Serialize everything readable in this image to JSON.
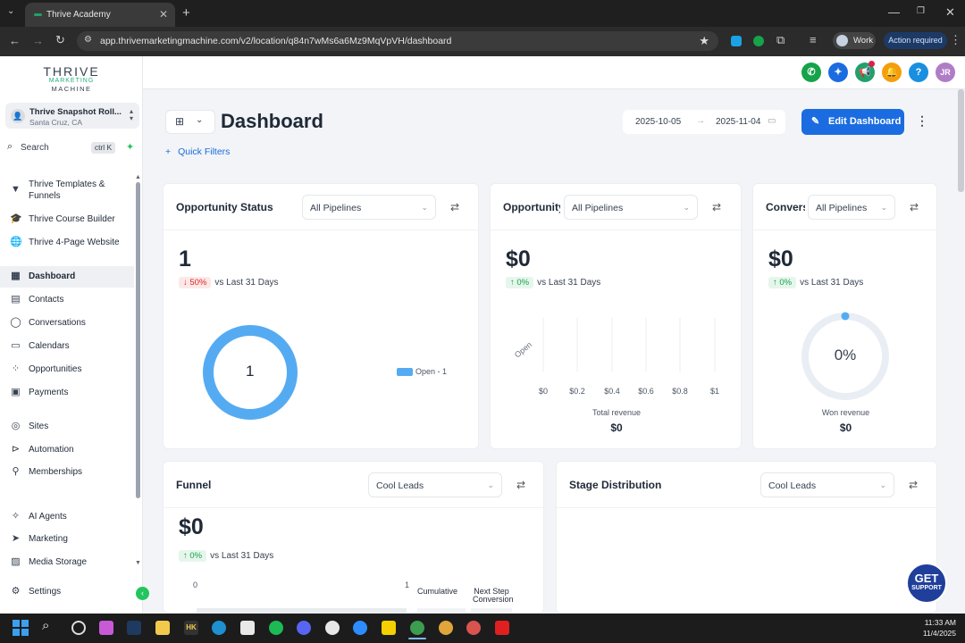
{
  "browser": {
    "tab_title": "Thrive Academy",
    "url": "app.thrivemarketingmachine.com/v2/location/q84n7wMs6a6Mz9MqVpVH/dashboard",
    "profile_label": "Work",
    "action_required": "Action required"
  },
  "sidebar": {
    "logo_line1": "THRIVE",
    "logo_line2": "MARKETING",
    "logo_line3": "MACHINE",
    "location_name": "Thrive Snapshot Roll...",
    "location_sub": "Santa Cruz, CA",
    "search_label": "Search",
    "search_shortcut": "ctrl K",
    "pinned": [
      {
        "label": "Thrive Templates &",
        "label2": "Funnels",
        "icon": "filter-icon"
      },
      {
        "label": "Thrive Course Builder",
        "icon": "graduation-cap-icon"
      },
      {
        "label": "Thrive 4-Page Website",
        "icon": "globe-icon"
      }
    ],
    "nav": [
      {
        "label": "Dashboard",
        "icon": "dashboard-icon",
        "active": true
      },
      {
        "label": "Contacts",
        "icon": "contacts-icon"
      },
      {
        "label": "Conversations",
        "icon": "chat-icon"
      },
      {
        "label": "Calendars",
        "icon": "calendar-icon"
      },
      {
        "label": "Opportunities",
        "icon": "opportunities-icon"
      },
      {
        "label": "Payments",
        "icon": "payments-icon"
      },
      {
        "label": "Sites",
        "icon": "sites-icon"
      },
      {
        "label": "Automation",
        "icon": "automation-icon"
      },
      {
        "label": "Memberships",
        "icon": "memberships-icon"
      },
      {
        "label": "AI Agents",
        "icon": "ai-agents-icon"
      },
      {
        "label": "Marketing",
        "icon": "marketing-icon"
      },
      {
        "label": "Media Storage",
        "icon": "media-icon"
      },
      {
        "label": "Settings",
        "icon": "gear-icon"
      }
    ]
  },
  "header": {
    "avatar_initials": "JR",
    "button_colors": [
      "#16a34a",
      "#1a6ce0",
      "#22a06b",
      "#f59e0b",
      "#1a8fe0",
      "#b07cc6"
    ]
  },
  "main": {
    "title": "Dashboard",
    "date_start": "2025-10-05",
    "date_end": "2025-11-04",
    "edit_label": "Edit Dashboard",
    "quick_filters": "Quick Filters"
  },
  "widgets": {
    "opp_status": {
      "title": "Opportunity Status",
      "pipeline": "All Pipelines",
      "value": "1",
      "delta": "50%",
      "delta_dir": "down",
      "vs": "vs Last 31 Days",
      "donut_value": "1",
      "legend": "Open - 1"
    },
    "opp_value": {
      "title": "Opportunity",
      "pipeline": "All Pipelines",
      "value": "$0",
      "delta": "0%",
      "vs": "vs Last 31 Days",
      "y_label": "Open",
      "ticks": [
        "$0",
        "$0.2",
        "$0.4",
        "$0.6",
        "$0.8",
        "$1"
      ],
      "x_label": "Total revenue",
      "total": "$0"
    },
    "conversion": {
      "title": "Convers",
      "pipeline": "All Pipelines",
      "value": "$0",
      "delta": "0%",
      "vs": "vs Last 31 Days",
      "gauge_value": "0%",
      "gauge_fraction": 0,
      "sub_label": "Won revenue",
      "sub_value": "$0"
    },
    "funnel": {
      "title": "Funnel",
      "pipeline": "Cool Leads",
      "value": "$0",
      "delta": "0%",
      "vs": "vs Last 31 Days",
      "axis_start": "0",
      "axis_end": "1",
      "col_cumulative": "Cumulative",
      "col_next_1": "Next Step",
      "col_next_2": "Conversion"
    },
    "stage": {
      "title": "Stage Distribution",
      "pipeline": "Cool Leads"
    }
  },
  "support": {
    "line1": "GET",
    "line2": "SUPPORT"
  },
  "taskbar": {
    "time": "11:33 AM",
    "date": "11/4/2025"
  }
}
